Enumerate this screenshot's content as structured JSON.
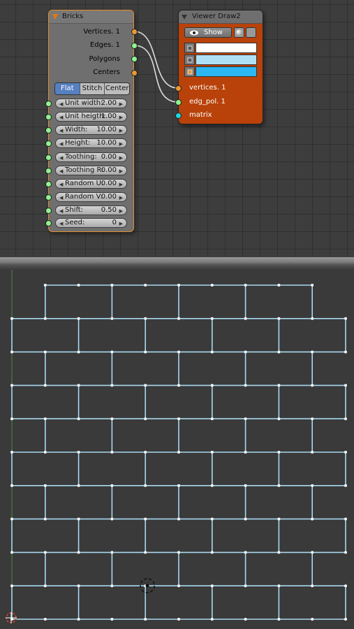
{
  "bricks_node": {
    "title": "Bricks",
    "outputs": [
      {
        "label": "Vertices. 1",
        "socket": "orange"
      },
      {
        "label": "Edges. 1",
        "socket": "green"
      },
      {
        "label": "Polygons",
        "socket": "green"
      },
      {
        "label": "Centers",
        "socket": "orange"
      }
    ],
    "modes": [
      "Flat",
      "Stitch",
      "Center"
    ],
    "active_mode": "Flat",
    "fields": [
      {
        "label": "Unit width:",
        "value": "2.00"
      },
      {
        "label": "Unit heigth:",
        "value": "1.00"
      },
      {
        "label": "Width:",
        "value": "10.00"
      },
      {
        "label": "Height:",
        "value": "10.00"
      },
      {
        "label": "Toothing:",
        "value": "0.00"
      },
      {
        "label": "Toothing R:",
        "value": "0.00"
      },
      {
        "label": "Random U:",
        "value": "0.00"
      },
      {
        "label": "Random V:",
        "value": "0.00"
      },
      {
        "label": "Shift:",
        "value": "0.50"
      },
      {
        "label": "Seed:",
        "value": "0"
      }
    ]
  },
  "viewer_node": {
    "title": "Viewer Draw2",
    "show_label": "Show",
    "color_swatches": [
      "#ffffff",
      "#aee0f5",
      "#2cb7f2"
    ],
    "inputs": [
      {
        "label": "vertices. 1",
        "socket": "orange"
      },
      {
        "label": "edg_pol. 1",
        "socket": "green"
      },
      {
        "label": "matrix",
        "socket": "cyan"
      }
    ]
  },
  "colors": {
    "bricks_border": "#e38d2b",
    "viewer_body": "#b8420a",
    "mesh_edge": "#a8d8f0",
    "mesh_vertex": "#ffffff",
    "active_mode": "#5680c2"
  }
}
